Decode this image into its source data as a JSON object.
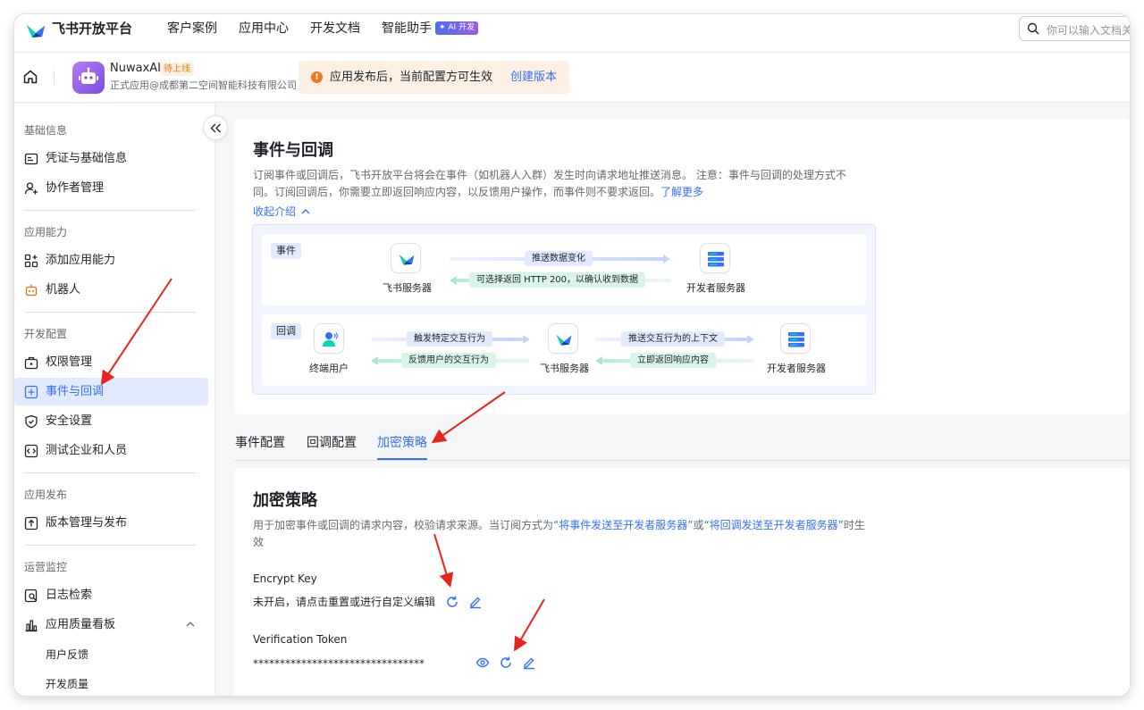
{
  "topnav": {
    "brand": "飞书开放平台",
    "items": [
      "客户案例",
      "应用中心",
      "开发文档",
      "智能助手"
    ],
    "ai_badge": "✦ AI 开发",
    "search_placeholder": "你可以输入文档关键词"
  },
  "appbar": {
    "app_name": "NuwaxAI",
    "app_status": "待上线",
    "app_org": "正式应用@成都第二空间智能科技有限公司",
    "notice_text": "应用发布后，当前配置方可生效",
    "notice_link": "创建版本"
  },
  "sidebar": {
    "sections": {
      "basic": "基础信息",
      "ability": "应用能力",
      "dev": "开发配置",
      "publish": "应用发布",
      "monitor": "运营监控"
    },
    "items": {
      "credentials": "凭证与基础信息",
      "collaborators": "协作者管理",
      "add_ability": "添加应用能力",
      "bot": "机器人",
      "permissions": "权限管理",
      "events": "事件与回调",
      "security": "安全设置",
      "test_company": "测试企业和人员",
      "versions": "版本管理与发布",
      "logs": "日志检索",
      "quality": "应用质量看板",
      "feedback": "用户反馈",
      "dev_quality": "开发质量"
    }
  },
  "intro": {
    "title": "事件与回调",
    "desc": "订阅事件或回调后，飞书开放平台将会在事件（如机器人入群）发生时向请求地址推送消息。 注意：事件与回调的处理方式不同。订阅回调后，你需要立即返回响应内容，以反馈用户操作，而事件则不要求返回。",
    "learn_more": "了解更多",
    "fold": "收起介绍"
  },
  "diagram": {
    "event": {
      "tag": "事件",
      "from": "飞书服务器",
      "to": "开发者服务器",
      "push": "推送数据变化",
      "reply": "可选择返回 HTTP 200，以确认收到数据"
    },
    "callback": {
      "tag": "回调",
      "user": "终端用户",
      "server": "飞书服务器",
      "dev": "开发者服务器",
      "trigger": "触发特定交互行为",
      "feedback": "反馈用户的交互行为",
      "push_ctx": "推送交互行为的上下文",
      "respond": "立即返回响应内容"
    }
  },
  "tabs": [
    "事件配置",
    "回调配置",
    "加密策略"
  ],
  "encrypt": {
    "title": "加密策略",
    "desc_pre": "用于加密事件或回调的请求内容，校验请求来源。当订阅方式为",
    "link1": "“将事件发送至开发者服务器”",
    "mid": "或",
    "link2": "“将回调发送至开发者服务器”",
    "desc_post": "时生效",
    "encrypt_key_label": "Encrypt Key",
    "encrypt_key_value": "未开启，请点击重置或进行自定义编辑",
    "token_label": "Verification Token",
    "token_value": "********************************"
  },
  "colors": {
    "accent": "#3370ff",
    "annotation": "#e8231c",
    "warning": "#f0771f"
  }
}
